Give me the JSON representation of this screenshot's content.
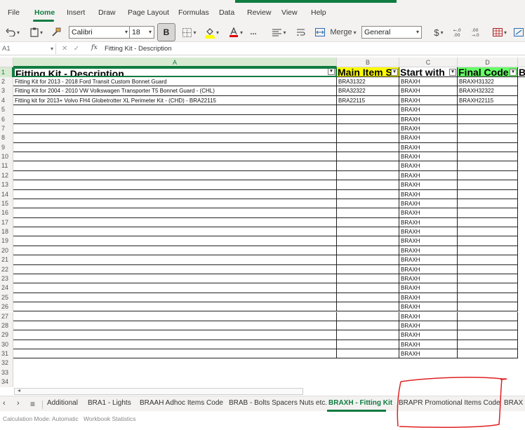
{
  "menu": [
    "File",
    "Home",
    "Insert",
    "Draw",
    "Page Layout",
    "Formulas",
    "Data",
    "Review",
    "View",
    "Help"
  ],
  "ribbon": {
    "font_name": "Calibri",
    "font_size": "18",
    "bold_label": "B",
    "more_label": "...",
    "merge_label": "Merge",
    "number_format": "General",
    "currency_label": "$"
  },
  "formula_bar": {
    "name_box": "A1",
    "fx_label": "fx",
    "content": "Fitting Kit - Description"
  },
  "columns": [
    {
      "letter": "A",
      "header": "Fitting Kit - Description",
      "color": "#ffffff"
    },
    {
      "letter": "B",
      "header": "Main Item S",
      "color": "#ffff00"
    },
    {
      "letter": "C",
      "header": "Start with",
      "color": "#ffffff"
    },
    {
      "letter": "D",
      "header": "Final Code",
      "color": "#66ff66"
    },
    {
      "letter": "",
      "header": "B",
      "color": "#ffffff"
    }
  ],
  "rows": [
    {
      "a": "Fitting Kit for 2013 - 2018 Ford Transit Custom Bonnet Guard",
      "b": "BRA31322",
      "c": "BRAXH",
      "d": "BRAXH31322"
    },
    {
      "a": "Fitting Kit for 2004 - 2010 VW Volkswagen Transporter T5 Bonnet Guard - (CHL)",
      "b": "BRA32322",
      "c": "BRAXH",
      "d": "BRAXH32322"
    },
    {
      "a": "Fitting kit for 2013+ Volvo FH4 Globetrotter XL Perimeter Kit - (CHD) - BRA22115",
      "b": "BRA22115",
      "c": "BRAXH",
      "d": "BRAXH22115"
    }
  ],
  "fill_value": "BRAXH",
  "row_numbers": [
    "1",
    "2",
    "3",
    "4",
    "5",
    "6",
    "7",
    "8",
    "9",
    "10",
    "11",
    "12",
    "13",
    "14",
    "15",
    "16",
    "17",
    "18",
    "19",
    "20",
    "21",
    "22",
    "23",
    "24",
    "25",
    "26",
    "27",
    "28",
    "29",
    "30",
    "31",
    "32",
    "33",
    "34"
  ],
  "sheet_tabs": [
    {
      "label": "Additional",
      "active": false
    },
    {
      "label": "BRA1 - Lights",
      "active": false
    },
    {
      "label": "BRAAH Adhoc Items Code",
      "active": false
    },
    {
      "label": "BRAB - Bolts Spacers Nuts etc.",
      "active": false
    },
    {
      "label": "BRAXH - Fitting Kit",
      "active": true
    },
    {
      "label": "BRAPR Promotional Items Code",
      "active": false
    },
    {
      "label": "BRAX -",
      "active": false
    }
  ],
  "status": {
    "calc_mode": "Calculation Mode: Automatic",
    "stats": "Workbook Statistics"
  },
  "colors": {
    "accent": "#107c41",
    "annotation": "#e02020"
  }
}
